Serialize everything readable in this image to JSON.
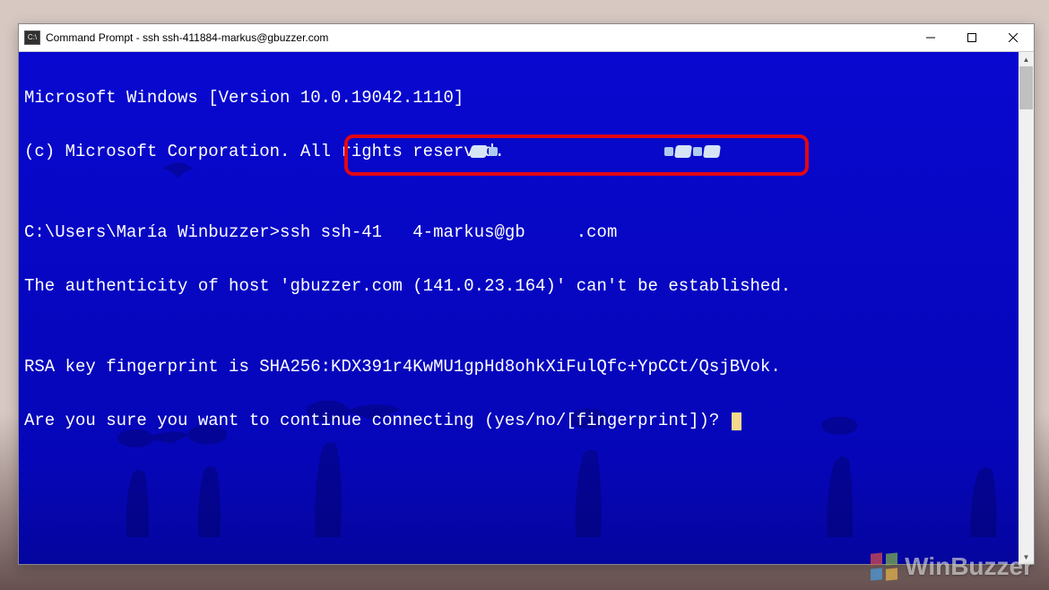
{
  "window": {
    "icon_label": "C:\\",
    "title": "Command Prompt - ssh  ssh-411884-markus@gbuzzer.com"
  },
  "console": {
    "line1": "Microsoft Windows [Version 10.0.19042.1110]",
    "line2": "(c) Microsoft Corporation. All rights reserved.",
    "blank1": "",
    "prompt_path": "C:\\Users\\María Winbuzzer>",
    "prompt_cmd": "ssh ssh-41",
    "prompt_mid": "4-markus@gb",
    "prompt_end": ".com",
    "line4": "The authenticity of host 'gbuzzer.com (141.0.23.164)' can't be established.",
    "blank2": "",
    "line5": "RSA key fingerprint is SHA256:KDX391r4KwMU1gpHd8ohkXiFulQfc+YpCCt/QsjBVok.",
    "line6": "Are you sure you want to continue connecting (yes/no/[fingerprint])? "
  },
  "watermark": {
    "text": "WinBuzzer"
  }
}
